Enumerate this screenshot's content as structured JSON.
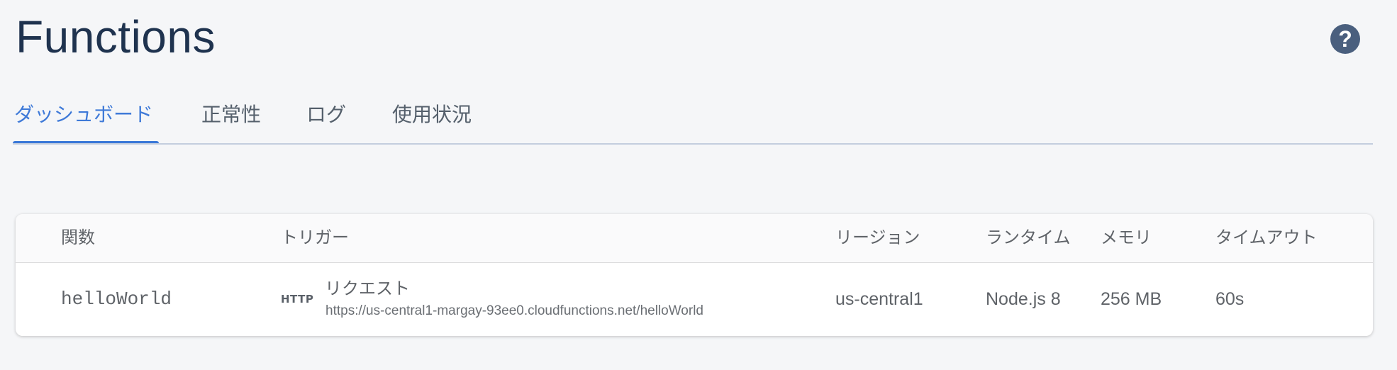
{
  "header": {
    "title": "Functions",
    "help_icon": "question-mark-icon",
    "help_label": "?"
  },
  "tabs": [
    {
      "label": "ダッシュボード",
      "active": true
    },
    {
      "label": "正常性",
      "active": false
    },
    {
      "label": "ログ",
      "active": false
    },
    {
      "label": "使用状況",
      "active": false
    }
  ],
  "colors": {
    "accent": "#3a78d8",
    "title": "#1f334f",
    "background": "#f5f6f8"
  },
  "table": {
    "columns": [
      "関数",
      "トリガー",
      "リージョン",
      "ランタイム",
      "メモリ",
      "タイムアウト"
    ],
    "rows": [
      {
        "function": "helloWorld",
        "trigger_badge": "HTTP",
        "trigger_type": "リクエスト",
        "trigger_url": "https://us-central1-margay-93ee0.cloudfunctions.net/helloWorld",
        "region": "us-central1",
        "runtime": "Node.js 8",
        "memory": "256 MB",
        "timeout": "60s"
      }
    ]
  }
}
